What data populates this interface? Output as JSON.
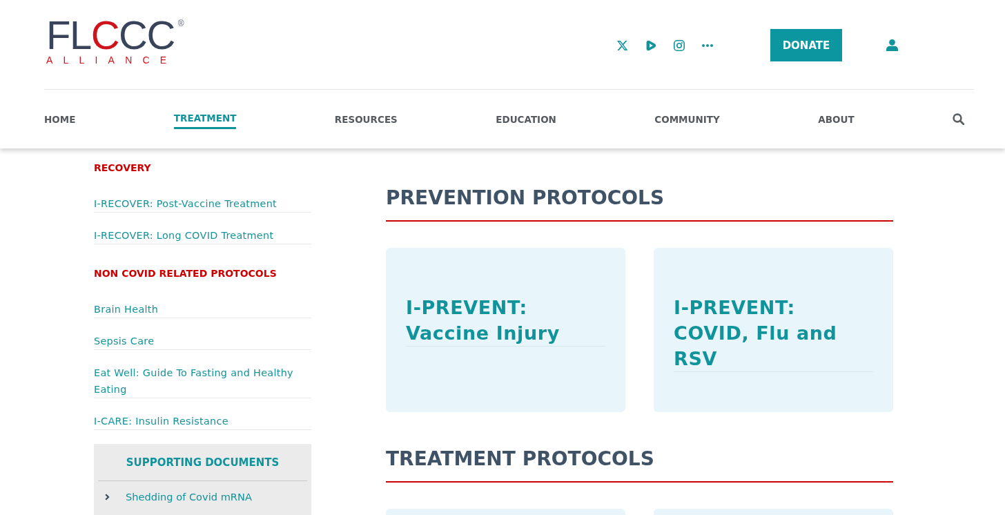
{
  "header": {
    "logo": {
      "name_parts": [
        {
          "text": "FL",
          "accent": false
        },
        {
          "text": "C",
          "accent": true
        },
        {
          "text": "CC",
          "accent": false
        }
      ],
      "registered_mark": "®",
      "tagline": "ALLIANCE"
    },
    "donate_button": "DONATE"
  },
  "nav": {
    "items": [
      {
        "label": "HOME",
        "selected": false
      },
      {
        "label": "TREATMENT",
        "selected": true
      },
      {
        "label": "RESOURCES",
        "selected": false
      },
      {
        "label": "EDUCATION",
        "selected": false
      },
      {
        "label": "COMMUNITY",
        "selected": false
      },
      {
        "label": "ABOUT",
        "selected": false
      }
    ]
  },
  "sidebar": {
    "sections": [
      {
        "heading": "RECOVERY",
        "links": [
          "I-RECOVER: Post-Vaccine Treatment",
          "I-RECOVER: Long COVID Treatment"
        ]
      },
      {
        "heading": "NON COVID RELATED PROTOCOLS",
        "links": [
          "Brain Health",
          "Sepsis Care",
          "Eat Well: Guide To Fasting and Healthy Eating",
          "I-CARE: Insulin Resistance"
        ]
      }
    ],
    "supporting_documents": {
      "heading": "SUPPORTING DOCUMENTS",
      "links": [
        "Shedding of Covid mRNA"
      ]
    }
  },
  "main": {
    "sections": [
      {
        "heading": "PREVENTION PROTOCOLS",
        "cards": [
          {
            "kind": "titled",
            "title": "I-PREVENT: Vaccine Injury"
          },
          {
            "kind": "titled",
            "title": "I-PREVENT: COVID, Flu and RSV"
          }
        ]
      },
      {
        "heading": "TREATMENT PROTOCOLS",
        "cards": [
          {
            "kind": "cut_off"
          },
          {
            "kind": "cut_off"
          }
        ]
      }
    ]
  }
}
